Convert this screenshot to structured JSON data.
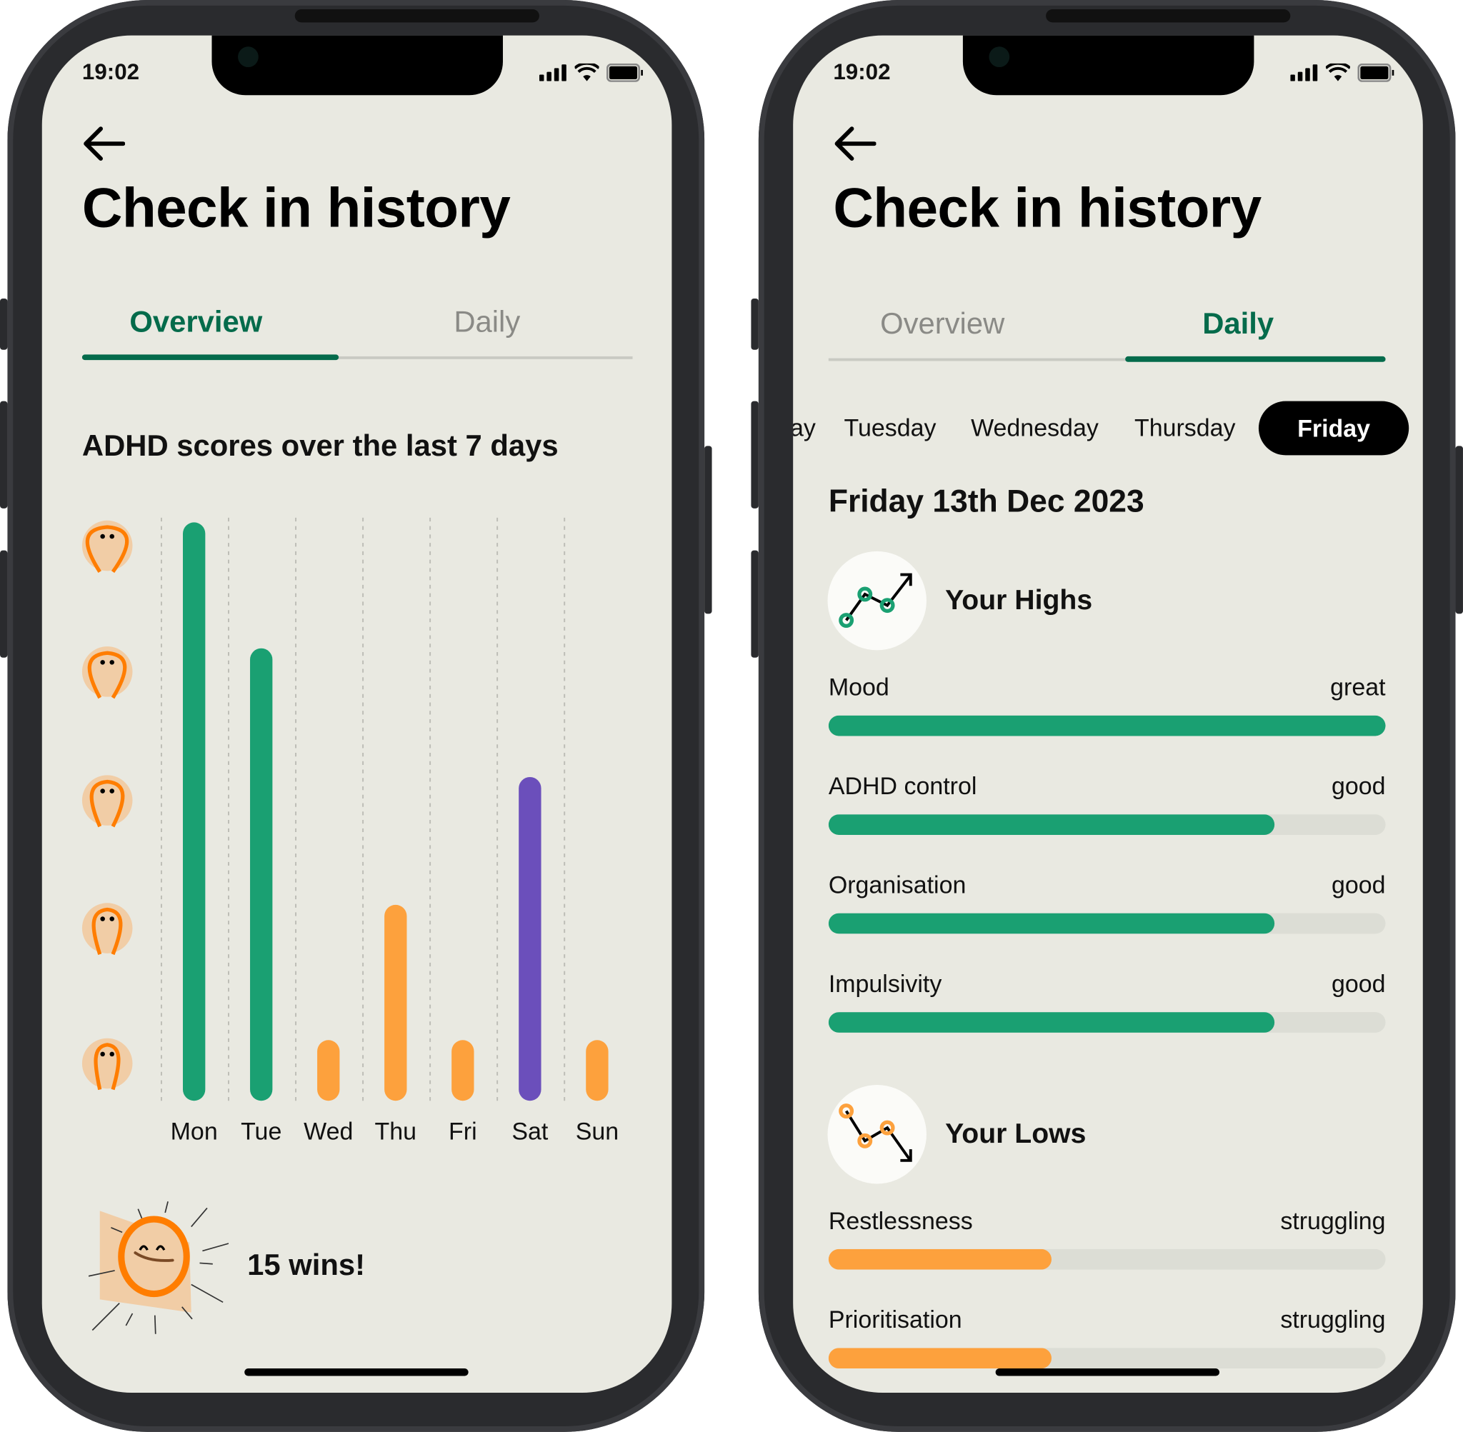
{
  "colors": {
    "accent_green": "#046b4b",
    "bar_green": "#1aa072",
    "bar_orange": "#fda13d",
    "bar_purple": "#6b4fbb",
    "background": "#e9e9e1"
  },
  "left_phone": {
    "status": {
      "time": "19:02",
      "icons": [
        "signal-icon",
        "wifi-icon",
        "battery-icon"
      ]
    },
    "back_icon": "arrow-left-icon",
    "title": "Check in history",
    "tabs": [
      {
        "label": "Overview",
        "active": true
      },
      {
        "label": "Daily",
        "active": false
      }
    ],
    "section_title": "ADHD scores over the last 7 days",
    "wins": "15 wins!"
  },
  "chart_data": {
    "type": "bar",
    "title": "ADHD scores over the last 7 days",
    "categories": [
      "Mon",
      "Tue",
      "Wed",
      "Thu",
      "Fri",
      "Sat",
      "Sun"
    ],
    "values": [
      5,
      4,
      1,
      2,
      1,
      3,
      1
    ],
    "ylim": [
      0,
      5
    ],
    "y_axis": "face illustrations for levels 1-5",
    "grid": "vertical dashed",
    "bar_colors": [
      "#1aa072",
      "#1aa072",
      "#fda13d",
      "#fda13d",
      "#fda13d",
      "#6b4fbb",
      "#fda13d"
    ]
  },
  "right_phone": {
    "status": {
      "time": "19:02"
    },
    "title": "Check in history",
    "tabs": [
      {
        "label": "Overview",
        "active": false
      },
      {
        "label": "Daily",
        "active": true
      }
    ],
    "days": [
      "Monday",
      "Tuesday",
      "Wednesday",
      "Thursday",
      "Friday"
    ],
    "selected_day": "Friday",
    "date": "Friday 13th Dec 2023",
    "highs": {
      "title": "Your Highs",
      "items": [
        {
          "label": "Mood",
          "value": "great",
          "level": 1.0
        },
        {
          "label": "ADHD control",
          "value": "good",
          "level": 0.8
        },
        {
          "label": "Organisation",
          "value": "good",
          "level": 0.8
        },
        {
          "label": "Impulsivity",
          "value": "good",
          "level": 0.8
        }
      ]
    },
    "lows": {
      "title": "Your Lows",
      "items": [
        {
          "label": "Restlessness",
          "value": "struggling",
          "level": 0.4
        },
        {
          "label": "Prioritisation",
          "value": "struggling",
          "level": 0.4
        }
      ]
    }
  }
}
